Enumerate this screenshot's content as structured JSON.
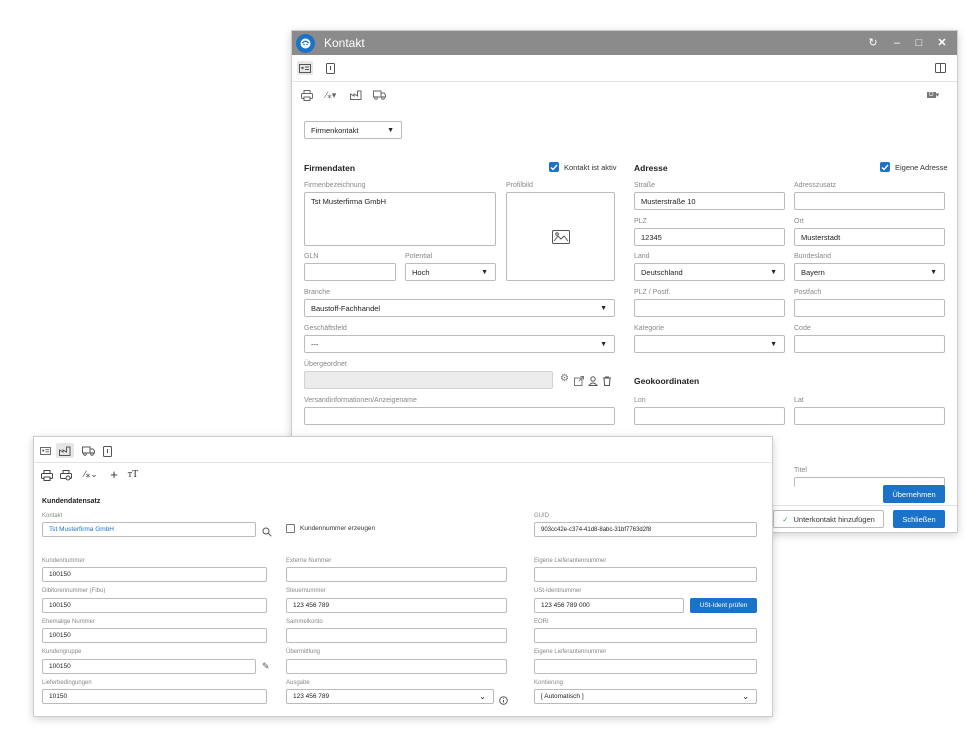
{
  "win1": {
    "title": "Kontakt",
    "contact_type": "Firmenkontakt",
    "firmendaten": {
      "heading": "Firmendaten",
      "aktiv_label": "Kontakt ist aktiv",
      "firmenbezeichnung_label": "Firmenbezeichnung",
      "firmenbezeichnung_value": "Tst Musterfirma GmbH",
      "profilbild_label": "Profilbild",
      "gln_label": "GLN",
      "gln_value": "",
      "potential_label": "Potential",
      "potential_value": "Hoch",
      "branche_label": "Branche",
      "branche_value": "Baustoff-Fachhandel",
      "geschaeftsfeld_label": "Geschäftsfeld",
      "geschaeftsfeld_value": "---",
      "uebergeordnet_label": "Übergeordnet",
      "versand_label": "Versandinformationen/Anzeigename"
    },
    "adresse": {
      "heading": "Adresse",
      "eigene_label": "Eigene Adresse",
      "strasse_label": "Straße",
      "strasse_value": "Musterstraße 10",
      "adresszusatz_label": "Adresszusatz",
      "plz_label": "PLZ",
      "plz_value": "12345",
      "ort_label": "Ort",
      "ort_value": "Musterstadt",
      "land_label": "Land",
      "land_value": "Deutschland",
      "bundesland_label": "Bundesland",
      "bundesland_value": "Bayern",
      "plzpostf_label": "PLZ / Postf.",
      "postfach_label": "Postfach",
      "kategorie_label": "Kategorie",
      "code_label": "Code"
    },
    "geo": {
      "heading": "Geokoordinaten",
      "lon_label": "Lon",
      "lat_label": "Lat"
    },
    "titel_label": "Titel",
    "uebernehmen": "Übernehmen",
    "unterkontakt": "Unterkontakt hinzufügen",
    "schliessen": "Schließen"
  },
  "win2": {
    "heading": "Kundendatensatz",
    "kontakt_label": "Kontakt",
    "kontakt_value": "Tst Musterfirma GmbH",
    "kundennummer_erzeugen": "Kundennummer erzeugen",
    "guid_label": "GUID",
    "guid_value": "903cc42e-c374-41d8-8abc-31bf7763d2f8",
    "kundennummer_label": "Kundennummer",
    "kundennummer_value": "100150",
    "externe_label": "Externe Nummer",
    "eigene_lief_label": "Eigene Lieferantennummer",
    "debitor_label": "Dibitorennummer (Fibu)",
    "debitor_value": "100150",
    "steuer_label": "Steuernummer",
    "steuer_value": "123 456 789",
    "ustid_label": "USt-Identnummer",
    "ustid_value": "123 456 789 000",
    "ustid_btn": "USt-Ident prüfen",
    "ehemalige_label": "Ehemalige Nummer",
    "ehemalige_value": "100150",
    "sammelkonto_label": "Sammelkonto",
    "eori_label": "EORI",
    "kundengruppe_label": "Kundengruppe",
    "kundengruppe_value": "100150",
    "uebermittlung_label": "Übermittlung",
    "eigene_lief2_label": "Eigene Lieferantennummer",
    "lieferbed_label": "Lieferbedingungen",
    "lieferbed_value": "10150",
    "ausgabe_label": "Ausgabe",
    "ausgabe_value": "123 456 789",
    "kontierung_label": "Kontierung",
    "kontierung_value": "[ Automatisch ]"
  }
}
